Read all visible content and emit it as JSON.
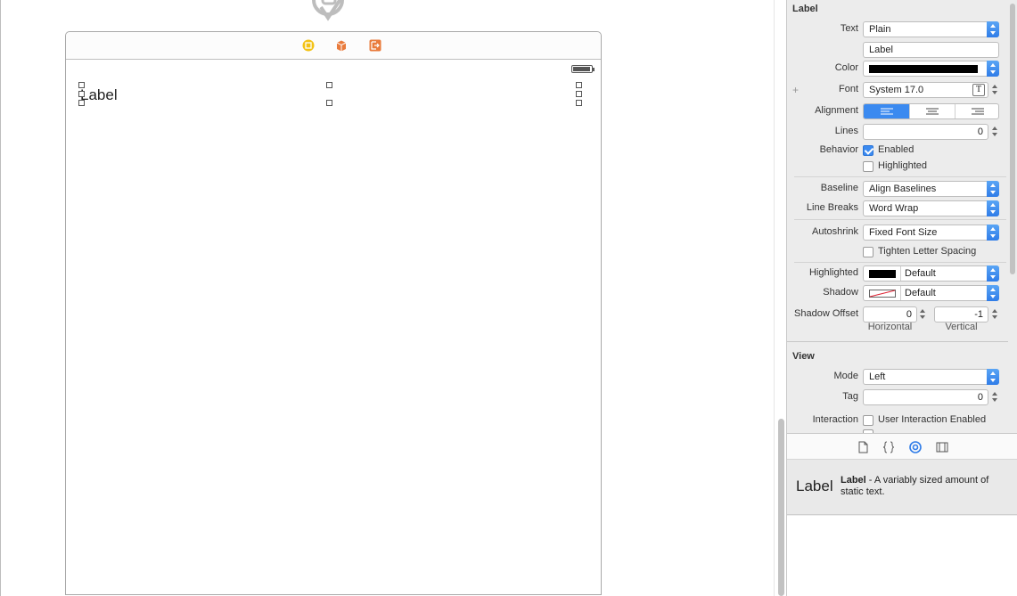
{
  "canvas": {
    "label_text": "Label"
  },
  "inspector": {
    "label_section": {
      "title": "Label",
      "text_label": "Text",
      "text_mode": "Plain",
      "text_value": "Label",
      "color_label": "Color",
      "color_value": "#000000",
      "font_label": "Font",
      "font_value": "System 17.0",
      "alignment_label": "Alignment",
      "alignment_selected": "left",
      "lines_label": "Lines",
      "lines_value": "0",
      "behavior_label": "Behavior",
      "enabled_label": "Enabled",
      "enabled_checked": true,
      "highlighted_check_label": "Highlighted",
      "highlighted_checked": false,
      "baseline_label": "Baseline",
      "baseline_value": "Align Baselines",
      "line_breaks_label": "Line Breaks",
      "line_breaks_value": "Word Wrap",
      "autoshrink_label": "Autoshrink",
      "autoshrink_value": "Fixed Font Size",
      "tighten_label": "Tighten Letter Spacing",
      "tighten_checked": false,
      "highlighted_label": "Highlighted",
      "highlighted_value": "Default",
      "shadow_label": "Shadow",
      "shadow_value": "Default",
      "shadow_offset_label": "Shadow Offset",
      "horizontal_value": "0",
      "vertical_value": "-1",
      "horizontal_label": "Horizontal",
      "vertical_label": "Vertical"
    },
    "view_section": {
      "title": "View",
      "mode_label": "Mode",
      "mode_value": "Left",
      "tag_label": "Tag",
      "tag_value": "0",
      "interaction_label": "Interaction",
      "user_interaction_label": "User Interaction Enabled",
      "user_interaction_checked": false
    },
    "library": {
      "tabs": [
        "file-template-icon",
        "code-snippet-icon",
        "object-library-icon",
        "media-library-icon"
      ],
      "selected_tab": "object-library-icon",
      "item_title": "Label",
      "item_name": "Label",
      "item_description": " - A variably sized amount of static text."
    }
  },
  "colors": {
    "accent": "#3b8af0",
    "dock_yellow": "#f3c215",
    "dock_orange": "#e97b3c"
  }
}
